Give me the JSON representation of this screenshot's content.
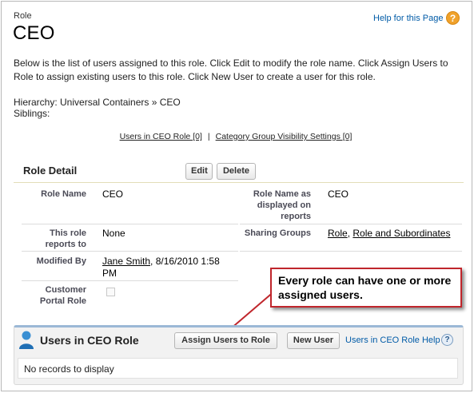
{
  "header": {
    "entity_type": "Role",
    "title": "CEO",
    "help_link": "Help for this Page",
    "help_icon": "help-icon"
  },
  "description": "Below is the list of users assigned to this role. Click Edit to modify the role name. Click Assign Users to Role to assign existing users to this role. Click New User to create a user for this role.",
  "hierarchy": "Hierarchy: Universal Containers » CEO",
  "siblings": "Siblings:",
  "related_links": {
    "users_link": "Users in CEO Role [0]",
    "separator": "|",
    "category_link": "Category Group Visibility Settings [0]"
  },
  "role_detail": {
    "heading": "Role Detail",
    "edit_label": "Edit",
    "delete_label": "Delete",
    "fields": {
      "role_name_label": "Role Name",
      "role_name_value": "CEO",
      "display_name_label": "Role Name as displayed on reports",
      "display_name_value": "CEO",
      "reports_to_label": "This role reports to",
      "reports_to_value": "None",
      "sharing_groups_label": "Sharing Groups",
      "sharing_group_1": "Role",
      "sharing_group_sep": ",",
      "sharing_group_2": "Role and Subordinates",
      "modified_by_label": "Modified By",
      "modified_by_user": "Jane Smith",
      "modified_by_date": ", 8/16/2010 1:58 PM",
      "customer_portal_label": "Customer Portal Role",
      "customer_portal_checked": false
    }
  },
  "callout": {
    "text": "Every role can have one or more assigned users.",
    "border_color": "#c0262c"
  },
  "users_list": {
    "icon": "user-icon",
    "title": "Users in CEO Role",
    "assign_label": "Assign Users to Role",
    "new_user_label": "New User",
    "help_link": "Users in CEO Role Help",
    "help_icon": "help-icon",
    "empty_text": "No records to display"
  },
  "colors": {
    "link": "#015ba7",
    "help_orange": "#f0a22b",
    "callout_red": "#c0262c",
    "list_accent": "#9bb8d6"
  }
}
